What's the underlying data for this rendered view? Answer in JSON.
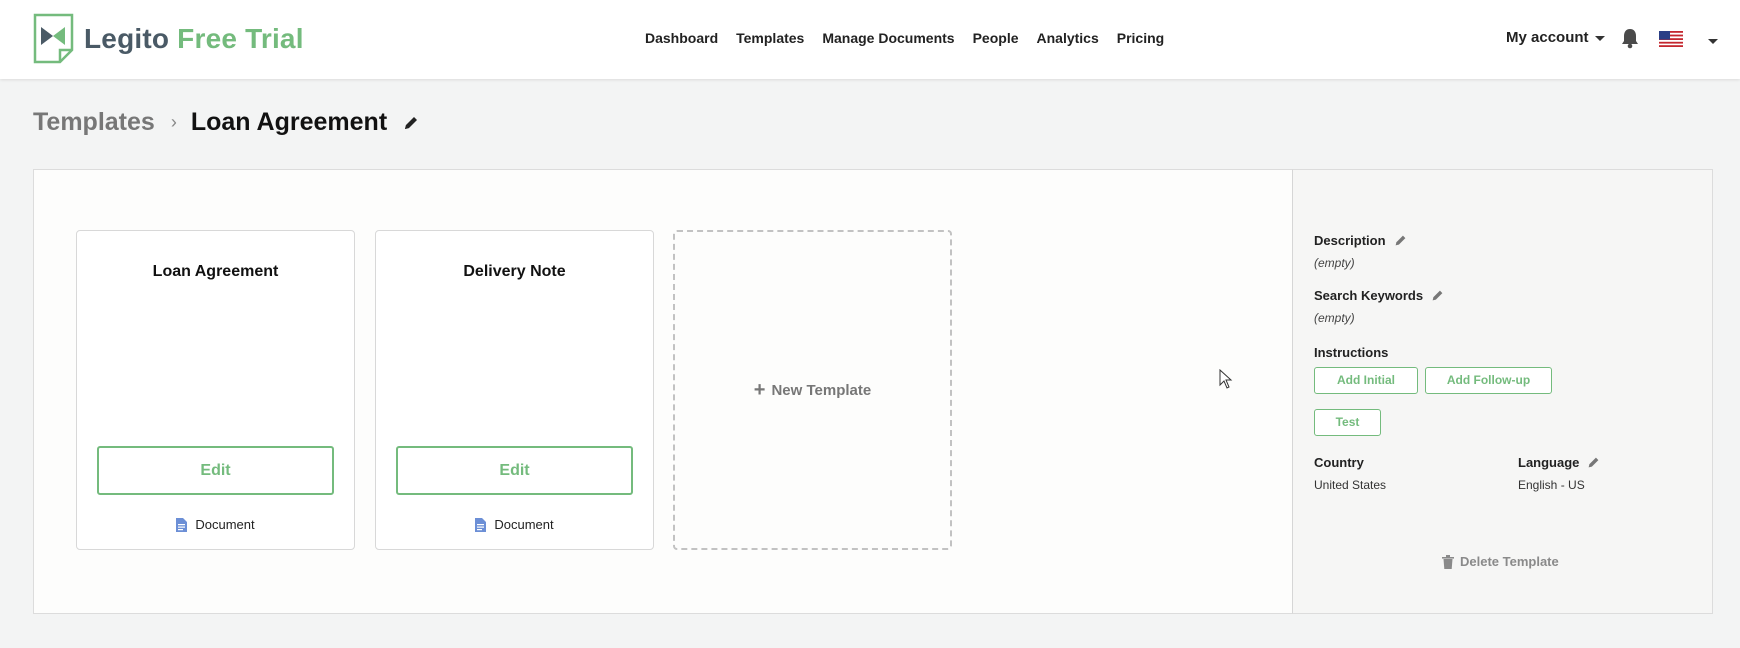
{
  "header": {
    "logo_main": "Legito",
    "logo_trial": "Free Trial",
    "nav": [
      "Dashboard",
      "Templates",
      "Manage Documents",
      "People",
      "Analytics",
      "Pricing"
    ],
    "account_label": "My account"
  },
  "breadcrumb": {
    "root": "Templates",
    "separator": "›",
    "current": "Loan Agreement"
  },
  "cards": [
    {
      "title": "Loan Agreement",
      "button": "Edit",
      "type": "Document"
    },
    {
      "title": "Delivery Note",
      "button": "Edit",
      "type": "Document"
    }
  ],
  "new_template": {
    "plus": "+",
    "label": "New Template"
  },
  "side": {
    "description_label": "Description",
    "description_value": "(empty)",
    "keywords_label": "Search Keywords",
    "keywords_value": "(empty)",
    "instructions_label": "Instructions",
    "add_initial": "Add Initial",
    "add_followup": "Add Follow-up",
    "test": "Test",
    "country_label": "Country",
    "country_value": "United States",
    "language_label": "Language",
    "language_value": "English - US",
    "delete_label": "Delete Template"
  },
  "colors": {
    "accent_green": "#74bb7d",
    "logo_gray": "#4a5a66",
    "doc_icon_blue": "#6c8fd6"
  },
  "icons": [
    "logo-mark",
    "caret-down-icon",
    "bell-icon",
    "us-flag-icon",
    "pencil-icon",
    "document-icon",
    "plus-icon",
    "trash-icon",
    "mouse-cursor-icon"
  ]
}
